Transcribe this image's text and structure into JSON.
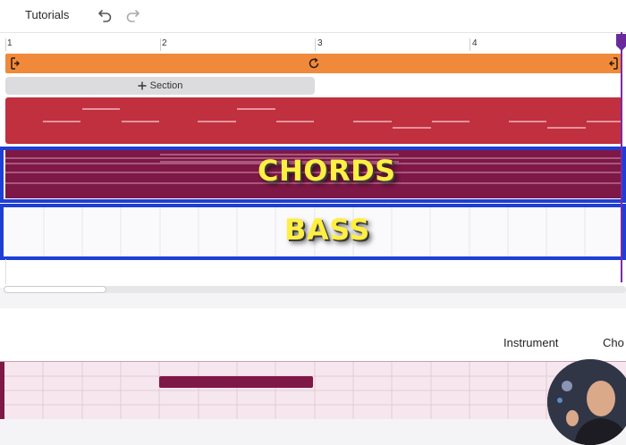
{
  "toolbar": {
    "tutorials_label": "Tutorials",
    "undo_icon": "undo-icon",
    "redo_icon": "redo-icon"
  },
  "ruler": {
    "bars": [
      "1",
      "2",
      "3",
      "4"
    ]
  },
  "loop": {
    "start_icon": "loop-start-icon",
    "loop_icon": "loop-icon",
    "end_icon": "loop-end-icon"
  },
  "section": {
    "label": "Section",
    "icon": "plus-icon"
  },
  "tracks": {
    "chords_overlay": "CHORDS",
    "bass_overlay": "BASS"
  },
  "lower_panel": {
    "instrument_label": "Instrument",
    "chords_label": "Cho"
  },
  "colors": {
    "loop": "#f08a3a",
    "melody": "#c0303f",
    "chords": "#7e1847",
    "highlight": "#1d3fd6",
    "overlay_text": "#ffef42",
    "playhead": "#7a2aa8"
  }
}
